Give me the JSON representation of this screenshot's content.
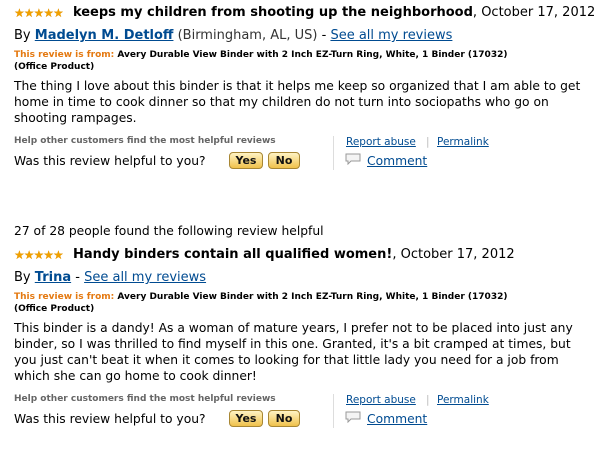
{
  "reviews": [
    {
      "stars": "★★★★★",
      "title": "keeps my children from shooting up the neighborhood",
      "date": "October 17, 2012",
      "by_label": "By",
      "reviewer": "Madelyn M. Detloff",
      "location": "(Birmingham, AL, US)",
      "see_all": "See all my reviews",
      "from_label": "This review is from:",
      "product": "Avery Durable View Binder with 2 Inch EZ-Turn Ring, White, 1 Binder (17032)",
      "product_type": "(Office Product)",
      "body": "The thing I love about this binder is that it helps me keep so organized that I am able to get home in time to cook dinner so that my children do not turn into sociopaths who go on shooting rampages.",
      "help_other": "Help other customers find the most helpful reviews",
      "helpful_q": "Was this review helpful to you?",
      "yes": "Yes",
      "no": "No",
      "report": "Report abuse",
      "permalink": "Permalink",
      "comment": "Comment"
    },
    {
      "helpful_summary": "27 of 28 people found the following review helpful",
      "stars": "★★★★★",
      "title": "Handy binders contain all qualified women!",
      "date": "October 17, 2012",
      "by_label": "By",
      "reviewer": "Trina",
      "see_all": "See all my reviews",
      "from_label": "This review is from:",
      "product": "Avery Durable View Binder with 2 Inch EZ-Turn Ring, White, 1 Binder (17032)",
      "product_type": "(Office Product)",
      "body": "This binder is a dandy! As a woman of mature years, I prefer not to be placed into just any binder, so I was thrilled to find myself in this one. Granted, it's a bit cramped at times, but you just can't beat it when it comes to looking for that little lady you need for a job from which she can go home to cook dinner!",
      "help_other": "Help other customers find the most helpful reviews",
      "helpful_q": "Was this review helpful to you?",
      "yes": "Yes",
      "no": "No",
      "report": "Report abuse",
      "permalink": "Permalink",
      "comment": "Comment"
    }
  ],
  "colors": {
    "link": "#004b91",
    "from_label": "#e47911",
    "star": "#f0a000"
  }
}
